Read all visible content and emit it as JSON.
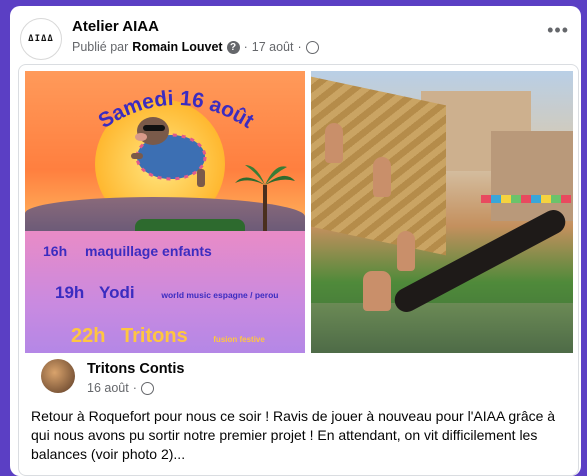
{
  "post": {
    "avatar_text": "ΔΙΔΔ",
    "page_name": "Atelier AIAA",
    "published_by_prefix": "Publié par",
    "author": "Romain Louvet",
    "date": "17 août",
    "more": "•••"
  },
  "poster": {
    "headline": "Samedi 16 août",
    "line1_time": "16h",
    "line1_text": "maquillage enfants",
    "line2_time": "19h",
    "line2_name": "Yodi",
    "line2_note": "world music espagne / perou",
    "line3_time": "22h",
    "line3_name": "Tritons",
    "line3_note": "fusion festive"
  },
  "shared": {
    "name": "Tritons Contis",
    "date": "16 août",
    "text": "Retour à Roquefort pour nous ce soir ! Ravis de jouer à nouveau pour l'AIAA grâce à qui nous avons pu sortir notre premier projet ! En attendant, on vit difficilement les balances (voir photo 2)..."
  },
  "colors": {
    "background": "#5b3fc4",
    "card": "#ffffff",
    "poster_text": "#3b2cc0",
    "poster_accent": "#ffc640"
  }
}
